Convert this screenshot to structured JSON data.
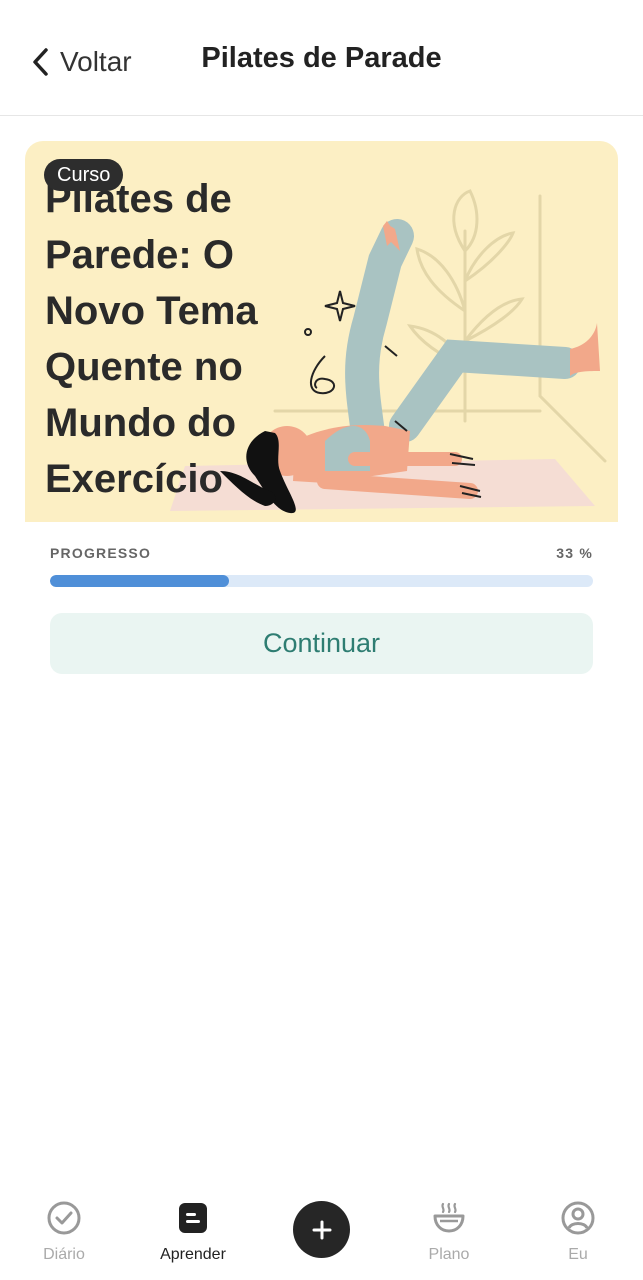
{
  "header": {
    "back_label": "Voltar",
    "title": "Pilates de Parade"
  },
  "course": {
    "badge": "Curso",
    "title": "Pilates de Parede: O Novo Tema Quente no Mundo do Exercício",
    "card_background": "#fcefc4"
  },
  "progress": {
    "label": "PROGRESSO",
    "percent_text": "33 %",
    "value": 0.33,
    "fill_color": "#4f8fd8",
    "track_color": "#dce9f8"
  },
  "continue_label": "Continuar",
  "tabs": [
    {
      "label": "Diário",
      "icon": "check-circle-icon",
      "active": false
    },
    {
      "label": "Aprender",
      "icon": "learn-icon",
      "active": true
    },
    {
      "label": "Plano",
      "icon": "bowl-icon",
      "active": false
    },
    {
      "label": "Eu",
      "icon": "profile-icon",
      "active": false
    }
  ],
  "fab": {
    "icon": "plus-icon"
  }
}
